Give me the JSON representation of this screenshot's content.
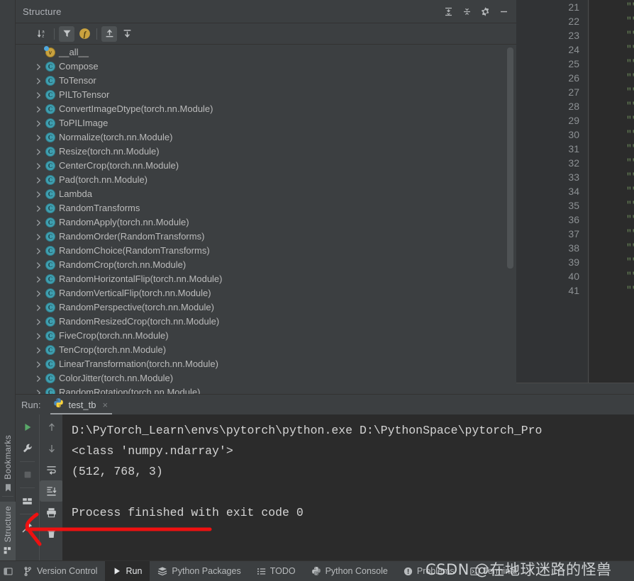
{
  "structure": {
    "title": "Structure",
    "header_buttons": [
      {
        "name": "expand-all-icon",
        "label": "Expand All"
      },
      {
        "name": "collapse-all-icon",
        "label": "Collapse All"
      },
      {
        "name": "gear-icon",
        "label": "Settings"
      },
      {
        "name": "minimize-icon",
        "label": "Hide"
      }
    ],
    "toolbar_buttons": [
      {
        "name": "sort-alphabetically-icon",
        "label": "Sort Alphabetically",
        "pressed": false
      },
      {
        "name": "filter-icon",
        "label": "Filter",
        "pressed": true
      },
      {
        "name": "show-fields-icon",
        "label": "Show Fields",
        "pressed": true
      },
      {
        "name": "expand-all-icon",
        "label": "Expand All",
        "pressed": true
      },
      {
        "name": "collapse-all-icon",
        "label": "Collapse All",
        "pressed": false
      }
    ],
    "tree": [
      {
        "label": "__all__",
        "icon": "variable-icon",
        "twisty": false
      },
      {
        "label": "Compose",
        "icon": "class-icon",
        "twisty": true
      },
      {
        "label": "ToTensor",
        "icon": "class-icon",
        "twisty": true
      },
      {
        "label": "PILToTensor",
        "icon": "class-icon",
        "twisty": true
      },
      {
        "label": "ConvertImageDtype(torch.nn.Module)",
        "icon": "class-icon",
        "twisty": true
      },
      {
        "label": "ToPILImage",
        "icon": "class-icon",
        "twisty": true
      },
      {
        "label": "Normalize(torch.nn.Module)",
        "icon": "class-icon",
        "twisty": true
      },
      {
        "label": "Resize(torch.nn.Module)",
        "icon": "class-icon",
        "twisty": true
      },
      {
        "label": "CenterCrop(torch.nn.Module)",
        "icon": "class-icon",
        "twisty": true
      },
      {
        "label": "Pad(torch.nn.Module)",
        "icon": "class-icon",
        "twisty": true
      },
      {
        "label": "Lambda",
        "icon": "class-icon",
        "twisty": true
      },
      {
        "label": "RandomTransforms",
        "icon": "class-icon",
        "twisty": true
      },
      {
        "label": "RandomApply(torch.nn.Module)",
        "icon": "class-icon",
        "twisty": true
      },
      {
        "label": "RandomOrder(RandomTransforms)",
        "icon": "class-icon",
        "twisty": true
      },
      {
        "label": "RandomChoice(RandomTransforms)",
        "icon": "class-icon",
        "twisty": true
      },
      {
        "label": "RandomCrop(torch.nn.Module)",
        "icon": "class-icon",
        "twisty": true
      },
      {
        "label": "RandomHorizontalFlip(torch.nn.Module)",
        "icon": "class-icon",
        "twisty": true
      },
      {
        "label": "RandomVerticalFlip(torch.nn.Module)",
        "icon": "class-icon",
        "twisty": true
      },
      {
        "label": "RandomPerspective(torch.nn.Module)",
        "icon": "class-icon",
        "twisty": true
      },
      {
        "label": "RandomResizedCrop(torch.nn.Module)",
        "icon": "class-icon",
        "twisty": true
      },
      {
        "label": "FiveCrop(torch.nn.Module)",
        "icon": "class-icon",
        "twisty": true
      },
      {
        "label": "TenCrop(torch.nn.Module)",
        "icon": "class-icon",
        "twisty": true
      },
      {
        "label": "LinearTransformation(torch.nn.Module)",
        "icon": "class-icon",
        "twisty": true
      },
      {
        "label": "ColorJitter(torch.nn.Module)",
        "icon": "class-icon",
        "twisty": true
      },
      {
        "label": "RandomRotation(torch.nn.Module)",
        "icon": "class-icon",
        "twisty": true
      }
    ]
  },
  "editor": {
    "line_numbers": [
      "21",
      "22",
      "23",
      "24",
      "25",
      "26",
      "27",
      "28",
      "29",
      "30",
      "31",
      "32",
      "33",
      "34",
      "35",
      "36",
      "37",
      "38",
      "39",
      "40",
      "41"
    ],
    "code_fragment": "\"\""
  },
  "run": {
    "label": "Run:",
    "tab": {
      "name": "test_tb",
      "icon": "python-icon",
      "close": "×"
    },
    "toolbar_left": [
      {
        "name": "rerun-icon",
        "label": "Rerun"
      },
      {
        "name": "wrench-icon",
        "label": "Edit Configuration"
      },
      {
        "name": "stop-icon",
        "label": "Stop"
      },
      {
        "name": "layout-icon",
        "label": "Layout Settings"
      },
      {
        "name": "pin-icon",
        "label": "Pin Tab"
      }
    ],
    "toolbar_right": [
      {
        "name": "arrow-up-icon",
        "label": "Up the Stack Trace"
      },
      {
        "name": "arrow-down-icon",
        "label": "Down the Stack Trace"
      },
      {
        "name": "soft-wrap-icon",
        "label": "Soft-Wrap"
      },
      {
        "name": "scroll-to-end-icon",
        "label": "Scroll to End",
        "pressed": true
      },
      {
        "name": "print-icon",
        "label": "Print"
      },
      {
        "name": "trash-icon",
        "label": "Clear All"
      }
    ],
    "console_lines": [
      "D:\\PyTorch_Learn\\envs\\pytorch\\python.exe D:\\PythonSpace\\pytorch_Pro",
      "<class 'numpy.ndarray'>",
      "(512, 768, 3)",
      "",
      "Process finished with exit code 0"
    ]
  },
  "left_rail": {
    "tabs": [
      {
        "label": "Bookmarks",
        "icon": "bookmark-icon",
        "active": false
      },
      {
        "label": "Structure",
        "icon": "structure-icon",
        "active": true
      }
    ]
  },
  "statusbar": {
    "items": [
      {
        "label": "Version Control",
        "icon": "branch-icon",
        "active": false
      },
      {
        "label": "Run",
        "icon": "play-icon",
        "active": true
      },
      {
        "label": "Python Packages",
        "icon": "packages-icon",
        "active": false
      },
      {
        "label": "TODO",
        "icon": "todo-icon",
        "active": false
      },
      {
        "label": "Python Console",
        "icon": "python-icon",
        "active": false
      },
      {
        "label": "Problems",
        "icon": "problems-icon",
        "active": false
      },
      {
        "label": "Terminal",
        "icon": "terminal-icon",
        "active": false
      }
    ]
  },
  "watermark": {
    "text": "CSDN @在地球迷路的怪兽"
  },
  "colors": {
    "panel_bg": "#3c3f41",
    "console_bg": "#2b2b2b",
    "editor_bg": "#313335",
    "text": "#bbbbbb",
    "class_icon": "#3f9fb0",
    "var_icon": "#c9a23f",
    "string_green": "#6a8759",
    "annotation_red": "#ee1111",
    "run_green": "#59a869"
  }
}
